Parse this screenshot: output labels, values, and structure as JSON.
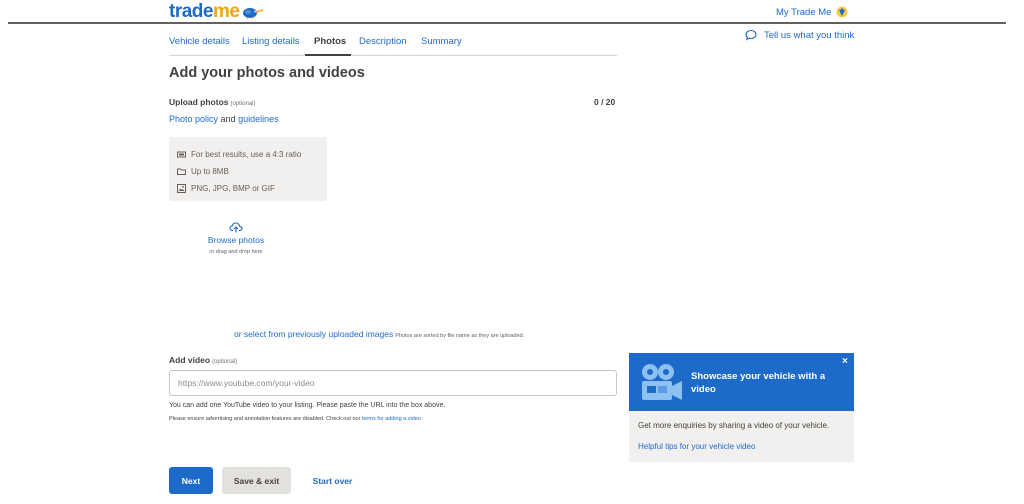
{
  "header": {
    "logo": {
      "part1": "trade",
      "part2": "me"
    },
    "my_trade_me": "My Trade Me"
  },
  "tabs": [
    {
      "label": "Vehicle details"
    },
    {
      "label": "Listing details"
    },
    {
      "label": "Photos"
    },
    {
      "label": "Description"
    },
    {
      "label": "Summary"
    }
  ],
  "active_tab": "Photos",
  "feedback": {
    "label": "Tell us what you think"
  },
  "main": {
    "title": "Add your photos and videos",
    "upload": {
      "label": "Upload photos",
      "optional": "(optional)",
      "count": "0 / 20",
      "policy_link": "Photo policy",
      "and": "and",
      "guidelines_link": "guidelines"
    },
    "tips": [
      {
        "icon": "ratio-icon",
        "text": "For best results, use a 4:3 ratio"
      },
      {
        "icon": "folder-icon",
        "text": "Up to 8MB"
      },
      {
        "icon": "image-icon",
        "text": "PNG, JPG, BMP or GIF"
      }
    ],
    "browse": {
      "link": "Browse photos",
      "sub": "or drag and drop here"
    },
    "select_previous": {
      "link": "or select from previously uploaded images",
      "note": "Photos are sorted by file name as they are uploaded."
    },
    "video": {
      "label": "Add video",
      "optional": "(optional)",
      "placeholder": "https://www.youtube.com/your-video",
      "value": "",
      "help1": "You can add one YouTube video to your listing. Please paste the URL into the box above.",
      "help2_text": "Please ensure advertising and annotation features are disabled. Check out our",
      "help2_link": "terms for adding a video"
    }
  },
  "buttons": {
    "next": "Next",
    "save_exit": "Save & exit",
    "start_over": "Start over"
  },
  "promo": {
    "close": "×",
    "title": "Showcase your vehicle with a video",
    "text": "Get more enquiries by sharing a video of your vehicle.",
    "link": "Helpful tips for your vehicle video"
  },
  "colors": {
    "brand_blue": "#1e6ac8",
    "brand_orange": "#f7a21b",
    "text": "#44413d",
    "panel_bg": "#f1f0ee"
  }
}
